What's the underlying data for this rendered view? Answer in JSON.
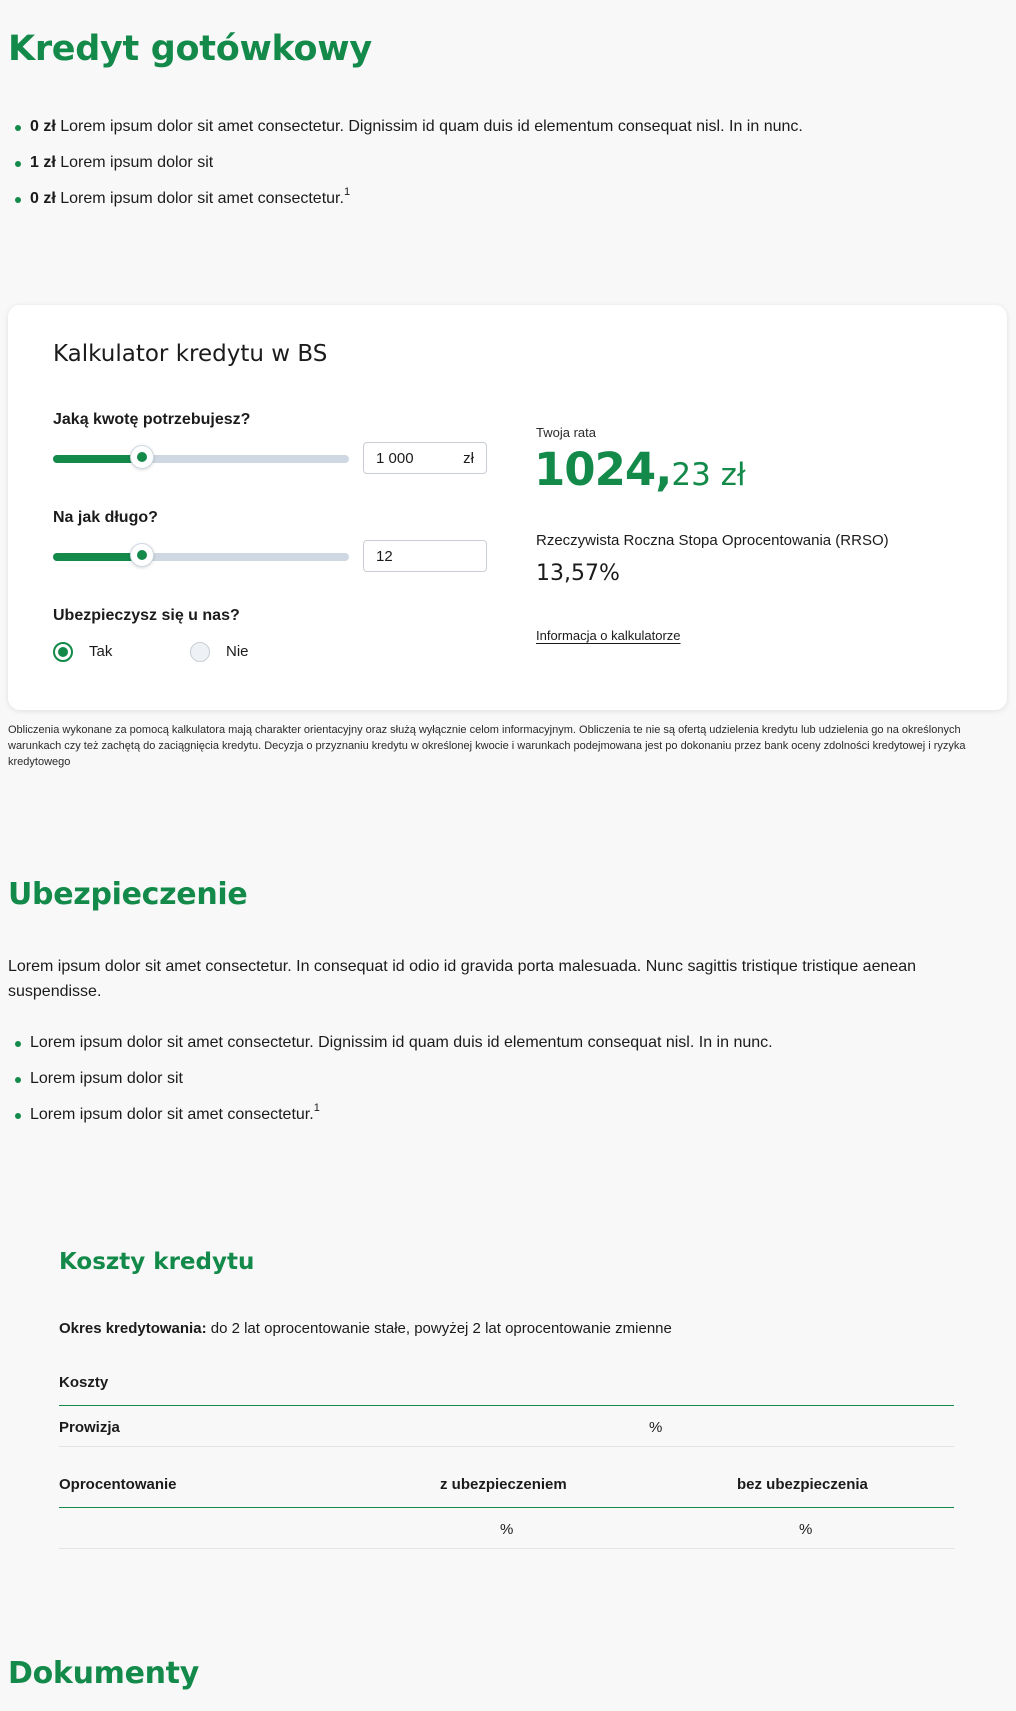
{
  "hero": {
    "title": "Kredyt gotówkowy",
    "bullets": [
      {
        "bold": "0 zł",
        "text": "Lorem ipsum dolor sit amet consectetur. Dignissim id quam duis id elementum consequat nisl. In in nunc.",
        "sup": ""
      },
      {
        "bold": "1 zł",
        "text": "Lorem ipsum dolor sit",
        "sup": ""
      },
      {
        "bold": "0 zł",
        "text": "Lorem ipsum dolor sit amet consectetur.",
        "sup": "1"
      }
    ]
  },
  "calculator": {
    "title": "Kalkulator kredytu w BS",
    "amount": {
      "label": "Jaką kwotę potrzebujesz?",
      "value": "1 000",
      "unit": "zł",
      "slider_fraction": 0.3
    },
    "term": {
      "label": "Na jak długo?",
      "value": "12",
      "slider_fraction": 0.3
    },
    "insurance": {
      "label": "Ubezpieczysz się u nas?",
      "options": [
        {
          "label": "Tak",
          "selected": true
        },
        {
          "label": "Nie",
          "selected": false
        }
      ]
    },
    "rate_label": "Twoja rata",
    "rate_int": "1024,",
    "rate_dec": "23 zł",
    "rrso_label": "Rzeczywista Roczna Stopa Oprocentowania (RRSO)",
    "rrso_value": "13,57%",
    "info_link": "Informacja o kalkulatorze",
    "disclaimer": "Obliczenia wykonane za pomocą kalkulatora mają charakter orientacyjny oraz służą wyłącznie celom informacyjnym. Obliczenia te nie są ofertą udzielenia kredytu lub udzielenia go na określonych warunkach czy też zachętą do zaciągnięcia kredytu. Decyzja o przyznaniu kredytu w określonej kwocie i warunkach podejmowana jest po dokonaniu przez bank oceny zdolności kredytowej i ryzyka kredytowego"
  },
  "insurance_section": {
    "title": "Ubezpieczenie",
    "paragraph": "Lorem ipsum dolor sit amet consectetur. In consequat id odio id gravida porta malesuada. Nunc sagittis tristique tristique aenean suspendisse.",
    "bullets": [
      {
        "text": "Lorem ipsum dolor sit amet consectetur. Dignissim id quam duis id elementum consequat nisl. In in nunc.",
        "sup": ""
      },
      {
        "text": "Lorem ipsum dolor sit",
        "sup": ""
      },
      {
        "text": "Lorem ipsum dolor sit amet consectetur.",
        "sup": "1"
      }
    ]
  },
  "costs": {
    "title": "Koszty kredytu",
    "period_label": "Okres kredytowania:",
    "period_text": "do 2 lat oprocentowanie stałe, powyżej 2 lat oprocentowanie zmienne",
    "table1_header": "Koszty",
    "row_prowizja_label": "Prowizja",
    "row_prowizja_value": "%",
    "table2_header": "Oprocentowanie",
    "col_with": "z ubezpieczeniem",
    "col_without": "bez ubezpieczenia",
    "row2_with": "%",
    "row2_without": "%"
  },
  "documents": {
    "title": "Dokumenty"
  },
  "colors": {
    "accent": "#138a4a",
    "slider_track": "#cfd8e2",
    "background": "#f8f8f8"
  }
}
